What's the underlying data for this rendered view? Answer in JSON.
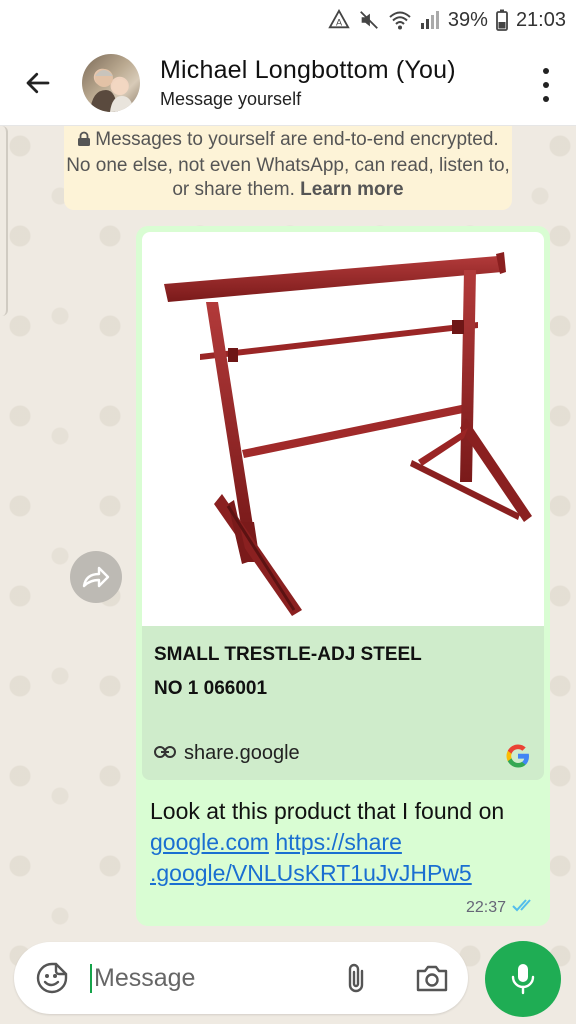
{
  "status_bar": {
    "battery": "39%",
    "time": "21:03",
    "icons": [
      "data-saver-icon",
      "mute-icon",
      "wifi-icon",
      "signal-icon",
      "battery-icon"
    ]
  },
  "header": {
    "contact_name": "Michael Longbottom (You)",
    "subtitle": "Message yourself",
    "icons": [
      "back-arrow-icon",
      "avatar",
      "more-vert-icon"
    ]
  },
  "encryption_notice": {
    "text": "Messages to yourself are end-to-end encrypted. No one else, not even WhatsApp, can read, listen to, or share them.",
    "link_label": "Learn more"
  },
  "message": {
    "preview": {
      "title": "SMALL TRESTLE-ADJ STEEL\nNO 1 066001",
      "domain": "share.google",
      "image_subject": "red steel trestle"
    },
    "text_before": "Look at this product that I found on ",
    "link1": "google.com",
    "link2": "https://share\n.google/VNLUsKRT1uJvJHPw5",
    "time": "22:37",
    "status": "read",
    "colors": {
      "bubble": "#d9fdd3",
      "link": "#1a6fd1",
      "ticks": "#53bdeb"
    }
  },
  "composer": {
    "placeholder": "Message",
    "icons": [
      "sticker-icon",
      "attach-icon",
      "camera-icon",
      "mic-icon"
    ]
  },
  "theme": {
    "accent": "#1fad54",
    "chat_background": "#efeae2",
    "notice_background": "#fdf3d7"
  }
}
